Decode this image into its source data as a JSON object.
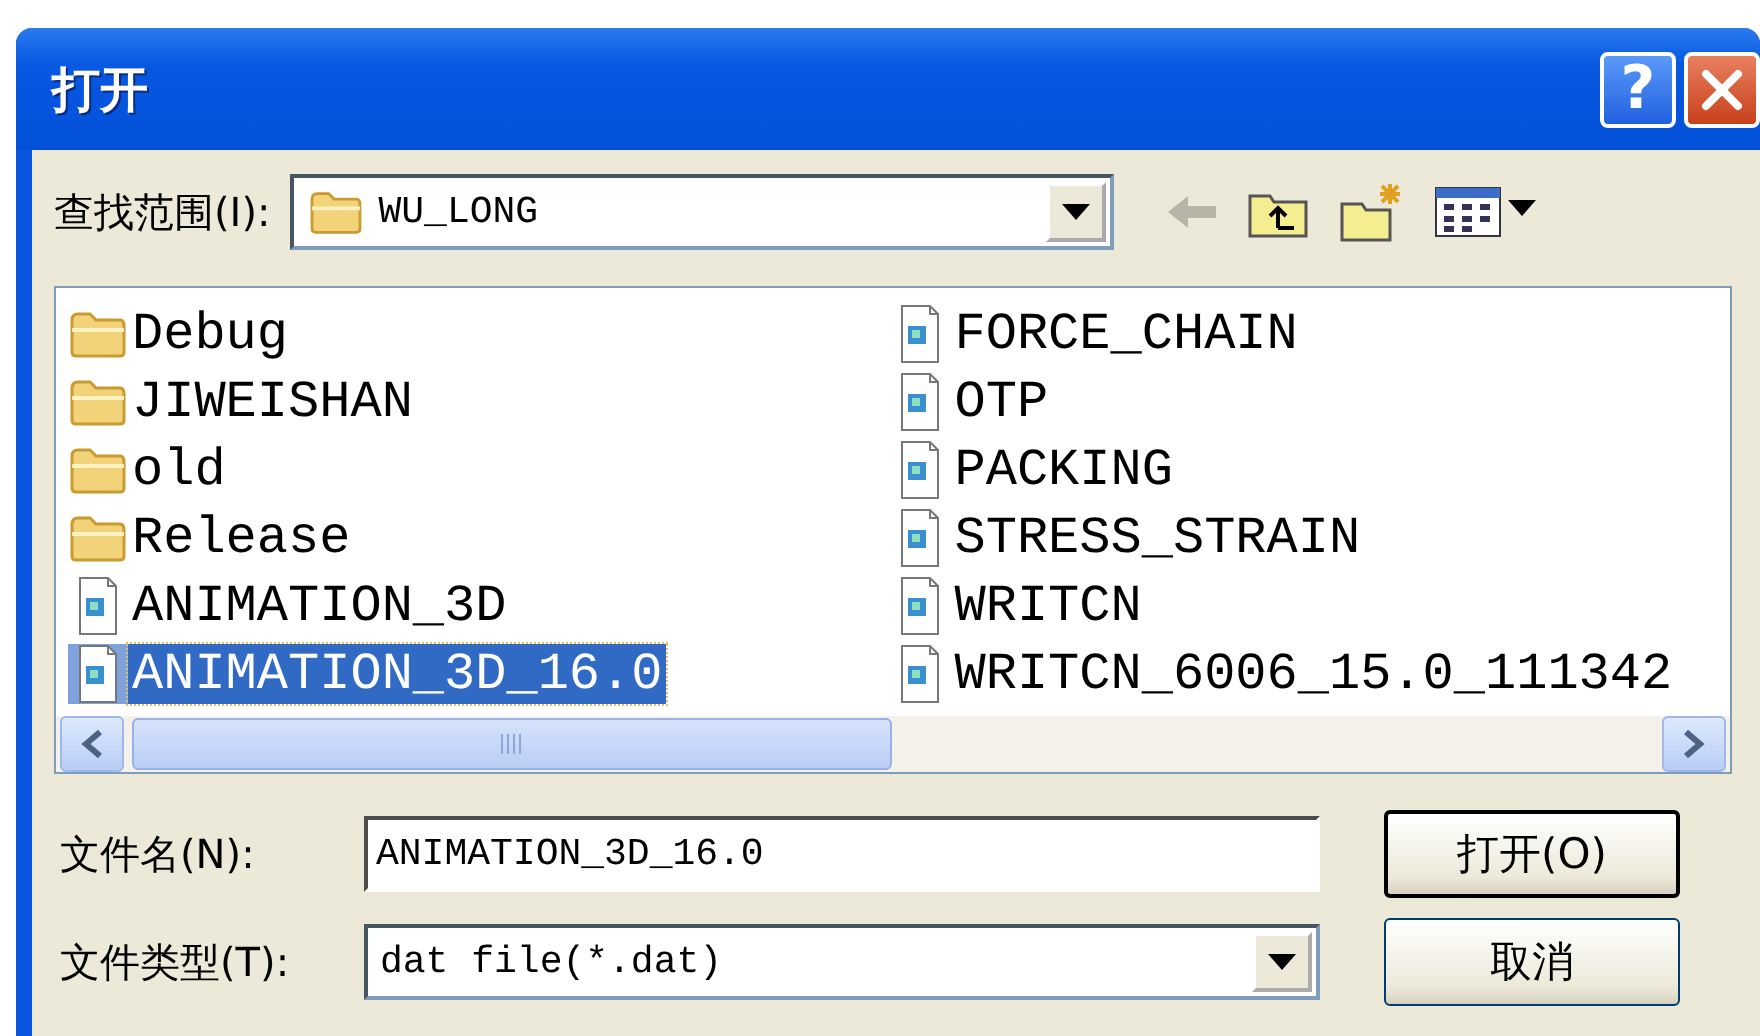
{
  "window": {
    "title": "打开",
    "help_button": "?"
  },
  "look_in": {
    "label": "查找范围(I):",
    "value": "WU_LONG"
  },
  "files": [
    {
      "name": "Debug",
      "kind": "folder",
      "selected": false
    },
    {
      "name": "JIWEISHAN",
      "kind": "folder",
      "selected": false
    },
    {
      "name": "old",
      "kind": "folder",
      "selected": false
    },
    {
      "name": "Release",
      "kind": "folder",
      "selected": false
    },
    {
      "name": "ANIMATION_3D",
      "kind": "file",
      "selected": false
    },
    {
      "name": "ANIMATION_3D_16.0",
      "kind": "file",
      "selected": true
    },
    {
      "name": "FORCE_CHAIN",
      "kind": "file",
      "selected": false
    },
    {
      "name": "OTP",
      "kind": "file",
      "selected": false
    },
    {
      "name": "PACKING",
      "kind": "file",
      "selected": false
    },
    {
      "name": "STRESS_STRAIN",
      "kind": "file",
      "selected": false
    },
    {
      "name": "WRITCN",
      "kind": "file",
      "selected": false
    },
    {
      "name": "WRITCN_6006_15.0_111342",
      "kind": "file",
      "selected": false
    }
  ],
  "file_name": {
    "label": "文件名(N):",
    "value": "ANIMATION_3D_16.0"
  },
  "file_type": {
    "label": "文件类型(T):",
    "value": "dat file(*.dat)"
  },
  "buttons": [
    "打开(O)",
    "取消"
  ]
}
